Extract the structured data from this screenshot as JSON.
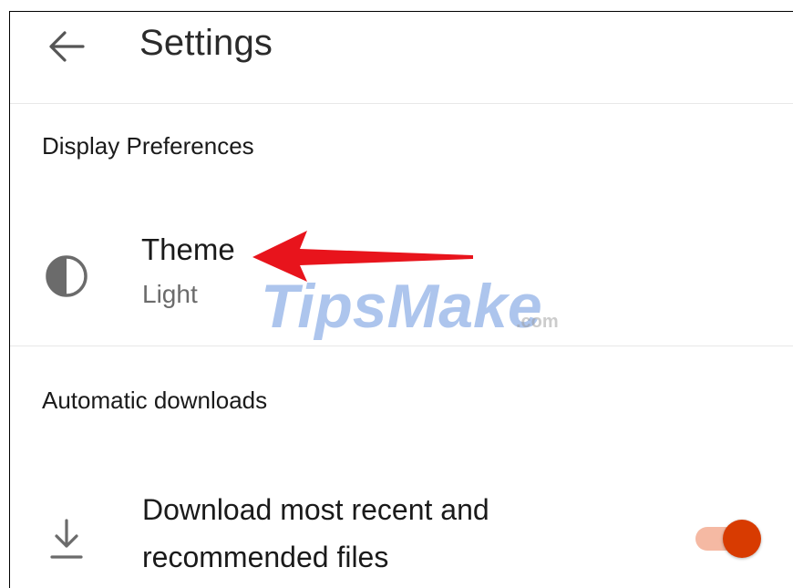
{
  "appbar": {
    "title": "Settings",
    "back_icon": "arrow-left-icon"
  },
  "sections": [
    {
      "header": "Display Preferences",
      "items": [
        {
          "title": "Theme",
          "subtitle": "Light",
          "icon": "half-circle-contrast-icon"
        }
      ]
    },
    {
      "header": "Automatic downloads",
      "items": [
        {
          "title_line1": "Download most recent and",
          "title_line2": "recommended files",
          "icon": "download-icon",
          "toggle_on": true
        }
      ]
    }
  ],
  "overlay": {
    "watermark_brand": "TipsMake",
    "watermark_suffix": ".com",
    "arrow_icon": "red-arrow-left-icon"
  },
  "colors": {
    "accent": "#d83b01",
    "toggle_track": "#f5b9a3",
    "annotation_red": "#e8141c",
    "watermark_blue": "#4a7fd6",
    "icon_gray": "#6b6b6b"
  }
}
